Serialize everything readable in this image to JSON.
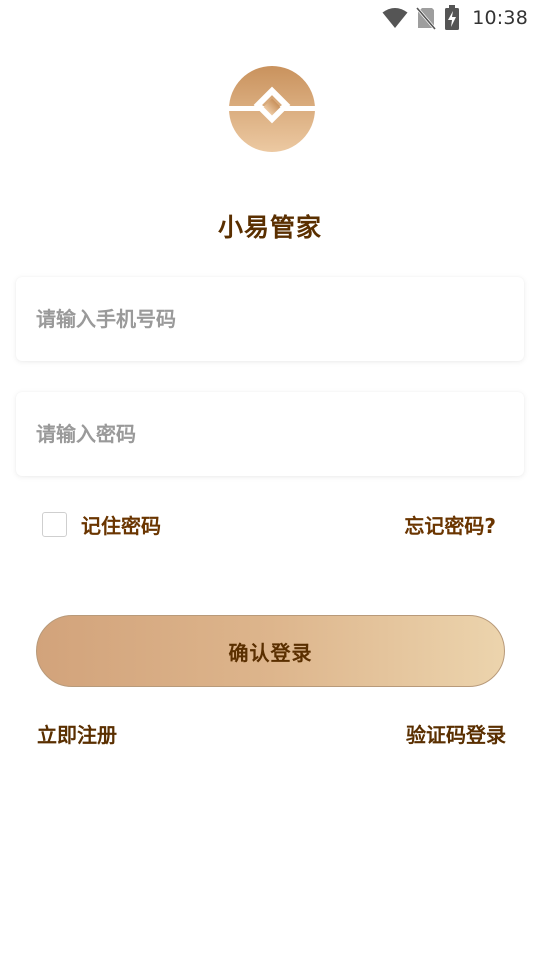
{
  "status_bar": {
    "time": "10:38",
    "icons": [
      "wifi-icon",
      "no-sim-icon",
      "battery-charging-icon"
    ]
  },
  "app": {
    "logo_icon": "app-logo-icon",
    "title": "小易管家"
  },
  "form": {
    "phone_placeholder": "请输入手机号码",
    "phone_value": "",
    "password_placeholder": "请输入密码",
    "password_value": "",
    "remember_label": "记住密码",
    "remember_checked": false,
    "forgot_label": "忘记密码?"
  },
  "actions": {
    "login_label": "确认登录",
    "register_label": "立即注册",
    "sms_login_label": "验证码登录"
  },
  "colors": {
    "accent_text": "#5a2f00",
    "button_gradient_start": "#d2a37b",
    "button_gradient_end": "#ecd4ad",
    "placeholder": "#9a9a9a"
  }
}
